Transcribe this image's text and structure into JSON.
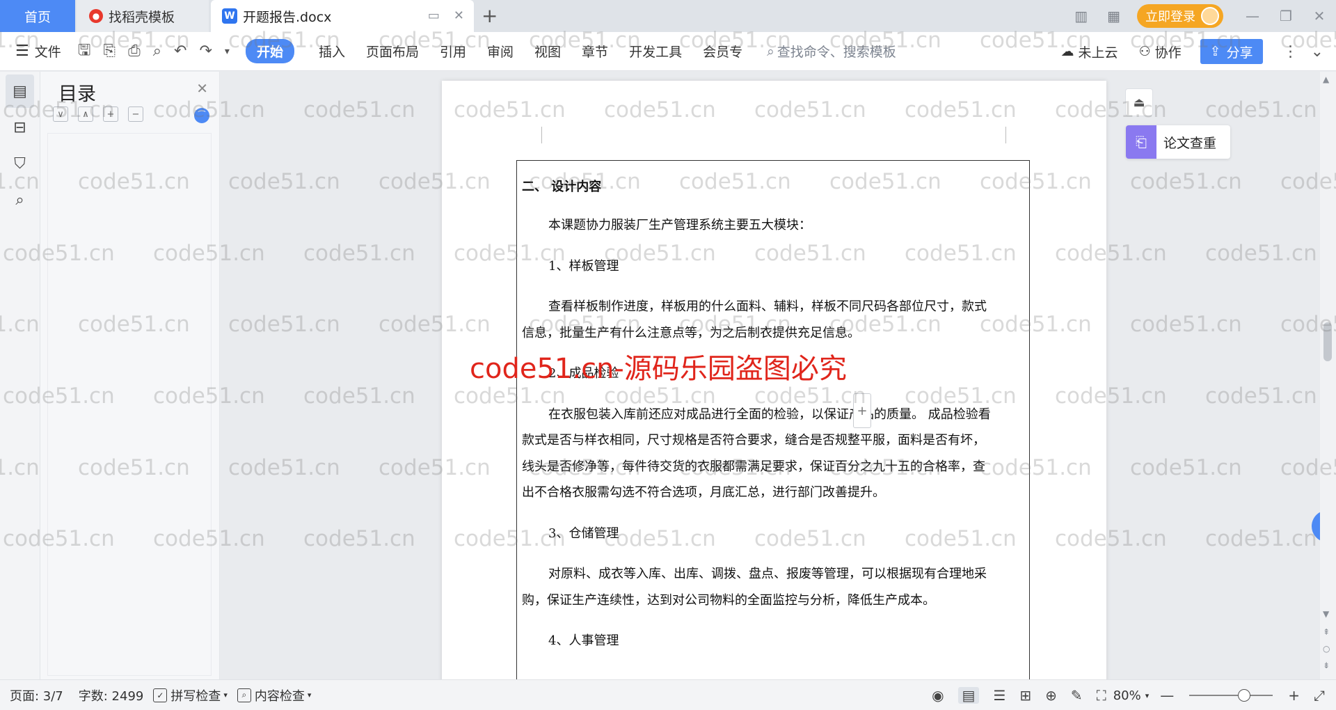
{
  "tabs": {
    "home": "首页",
    "templates": "找稻壳模板",
    "document": "开题报告.docx"
  },
  "window": {
    "login": "立即登录"
  },
  "ribbon": {
    "menu_label": "文件",
    "start": "开始",
    "insert": "插入",
    "page_layout": "页面布局",
    "reference": "引用",
    "review": "审阅",
    "view": "视图",
    "chapter": "章节",
    "developer": "开发工具",
    "member": "会员专",
    "search_placeholder": "查找命令、搜索模板",
    "cloud": "未上云",
    "collab": "协作",
    "share": "分享"
  },
  "toc": {
    "title": "目录"
  },
  "document": {
    "section_title": "二、 设计内容",
    "intro": "本课题协力服装厂生产管理系统主要五大模块：",
    "m1_title": "1、样板管理",
    "m1_text_a": "查看样板制作进度，样板用的什么面料、辅料，样板不同尺码各部位尺寸，款式",
    "m1_text_b": "信息，批量生产有什么注意点等，为之后制衣提供充足信息。",
    "m2_title": "2、成品检验",
    "m2_text_a": "在衣服包装入库前还应对成品进行全面的检验，以保证产品的质量。 成品检验看",
    "m2_text_b": "款式是否与样衣相同，尺寸规格是否符合要求，缝合是否规整平服，面料是否有坏，",
    "m2_text_c": "线头是否修净等，每件待交货的衣服都需满足要求，保证百分之九十五的合格率，查",
    "m2_text_d": "出不合格衣服需勾选不符合选项，月底汇总，进行部门改善提升。",
    "m3_title": "3、仓储管理",
    "m3_text_a": "对原料、成衣等入库、出库、调拨、盘点、报废等管理，可以根据现有合理地采",
    "m3_text_b": "购，保证生产连续性，达到对公司物料的全面监控与分析，降低生产成本。",
    "m4_title": "4、人事管理"
  },
  "side": {
    "plag_check": "论文查重"
  },
  "watermark": {
    "text": "code51.cn",
    "banner": "code51.cn-源码乐园盗图必究"
  },
  "status": {
    "page": "页面: 3/7",
    "words": "字数: 2499",
    "spell": "拼写检查",
    "content": "内容检查",
    "zoom": "80%"
  }
}
